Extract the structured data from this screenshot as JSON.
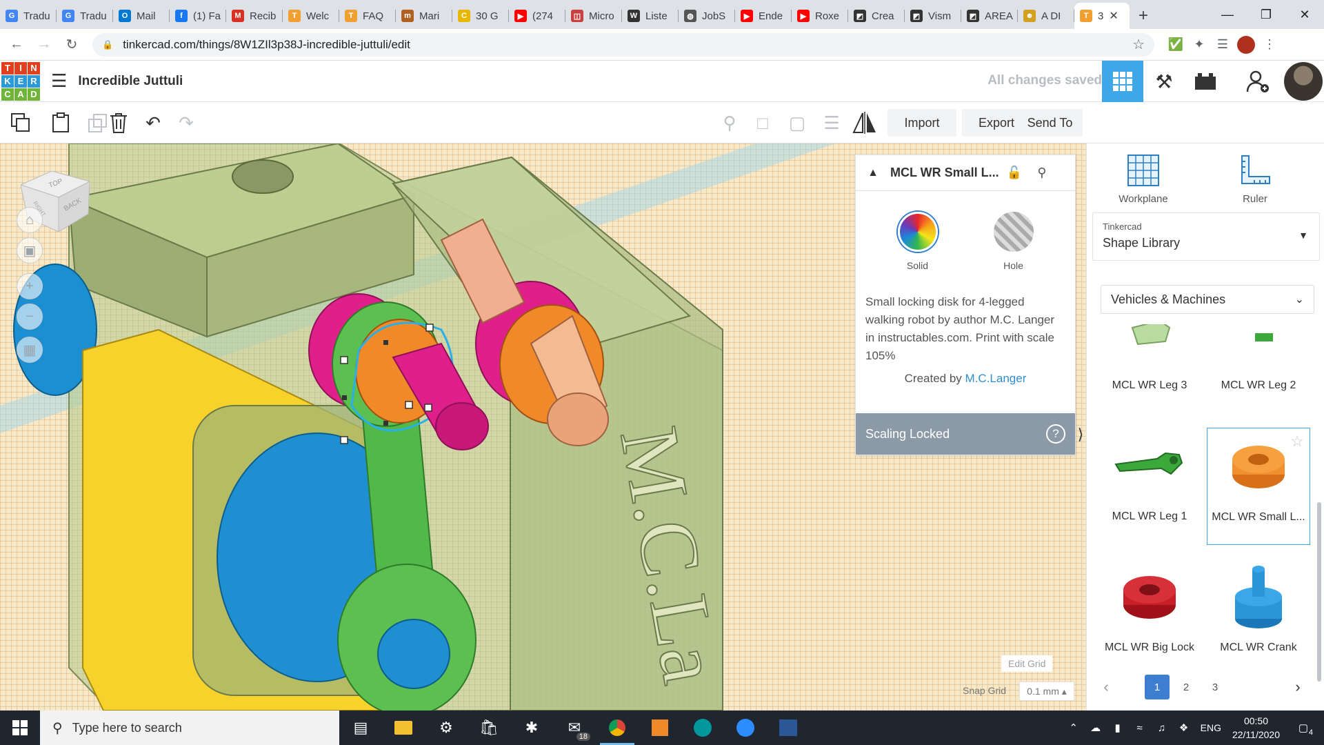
{
  "browser": {
    "tabs": [
      {
        "label": "Tradu",
        "color": "#4285f4",
        "glyph": "G"
      },
      {
        "label": "Tradu",
        "color": "#4285f4",
        "glyph": "G"
      },
      {
        "label": "Mail",
        "color": "#0078d4",
        "glyph": "O"
      },
      {
        "label": "(1) Fa",
        "color": "#1877f2",
        "glyph": "f"
      },
      {
        "label": "Recib",
        "color": "#d93025",
        "glyph": "M"
      },
      {
        "label": "Welc",
        "color": "#f0a030",
        "glyph": "T"
      },
      {
        "label": "FAQ",
        "color": "#f0a030",
        "glyph": "T"
      },
      {
        "label": "Mari",
        "color": "#b06020",
        "glyph": "m"
      },
      {
        "label": "30 G",
        "color": "#e8b800",
        "glyph": "C"
      },
      {
        "label": "(274",
        "color": "#ff0000",
        "glyph": "▶"
      },
      {
        "label": "Micro",
        "color": "#c84040",
        "glyph": "◫"
      },
      {
        "label": "Liste",
        "color": "#333333",
        "glyph": "W"
      },
      {
        "label": "JobS",
        "color": "#555555",
        "glyph": "◍"
      },
      {
        "label": "Ende",
        "color": "#ff0000",
        "glyph": "▶"
      },
      {
        "label": "Roxe",
        "color": "#ff0000",
        "glyph": "▶"
      },
      {
        "label": "Crea",
        "color": "#333333",
        "glyph": "◩"
      },
      {
        "label": "Vism",
        "color": "#333333",
        "glyph": "◩"
      },
      {
        "label": "AREA",
        "color": "#333333",
        "glyph": "◩"
      },
      {
        "label": "A DI",
        "color": "#d4a020",
        "glyph": "☻"
      },
      {
        "label": "3",
        "color": "#f0a030",
        "glyph": "T",
        "active": true
      }
    ],
    "url": "tinkercad.com/things/8W1ZIl3p38J-incredible-juttuli/edit"
  },
  "app": {
    "logo_letters": [
      "T",
      "I",
      "N",
      "K",
      "E",
      "R",
      "C",
      "A",
      "D"
    ],
    "logo_colors": [
      "#e0401e",
      "#e0401e",
      "#e0401e",
      "#2c9ad8",
      "#2c9ad8",
      "#2c9ad8",
      "#71b43a",
      "#71b43a",
      "#71b43a"
    ],
    "title": "Incredible Juttuli",
    "save_status": "All changes saved"
  },
  "toolbar": {
    "import_label": "Import",
    "export_label": "Export",
    "sendto_label": "Send To"
  },
  "inspector": {
    "shape_name": "MCL WR Small L...",
    "solid_label": "Solid",
    "hole_label": "Hole",
    "description": "Small locking disk for 4-legged walking robot by author M.C. Langer in instructables.com. Print with scale 105%",
    "created_by_prefix": "Created by",
    "author": "M.C.Langer",
    "scaling_label": "Scaling Locked"
  },
  "grid": {
    "edit_label": "Edit Grid",
    "snap_label": "Snap Grid",
    "snap_value": "0.1 mm ▴"
  },
  "viewcube": {
    "top": "TOP",
    "back": "BACK",
    "right": "RIGHT"
  },
  "rpanel": {
    "workplane_label": "Workplane",
    "ruler_label": "Ruler",
    "library_source": "Tinkercad",
    "library_name": "Shape Library",
    "category": "Vehicles & Machines",
    "shapes": [
      {
        "label": "MCL WR Leg 3",
        "color": "#a8d88a"
      },
      {
        "label": "MCL WR Leg 2",
        "color": "#3aa83a"
      },
      {
        "label": "MCL WR Leg 1",
        "color": "#3aa83a"
      },
      {
        "label": "MCL WR Small L...",
        "color": "#f09030"
      },
      {
        "label": "MCL WR Big Lock",
        "color": "#c81e28"
      },
      {
        "label": "MCL WR Crank",
        "color": "#2a96d8"
      }
    ],
    "pages": [
      "1",
      "2",
      "3"
    ]
  },
  "taskbar": {
    "search_placeholder": "Type here to search",
    "mail_badge": "18",
    "lang": "ENG",
    "time": "00:50",
    "date": "22/11/2020",
    "notif_count": "4"
  },
  "scene": {
    "engraved_text": "M.C.La"
  }
}
